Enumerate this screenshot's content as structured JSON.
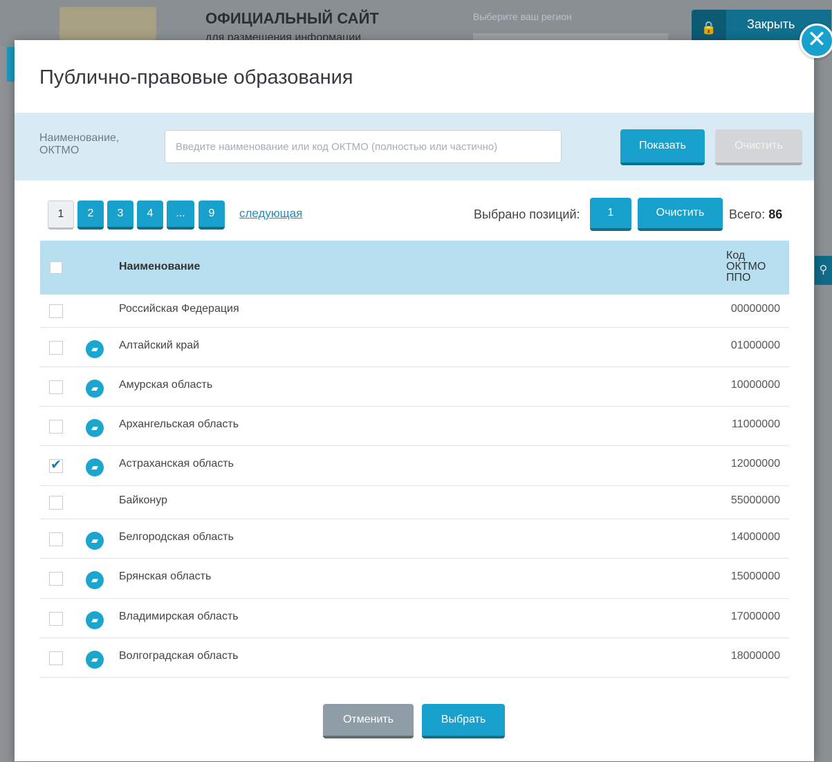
{
  "background": {
    "site_title": "ОФИЦИАЛЬНЫЙ САЙТ",
    "site_subtitle": "для размещения информации",
    "region_label": "Выберите ваш регион",
    "close_label": "Закрыть"
  },
  "modal": {
    "title": "Публично-правовые образования",
    "filter": {
      "label": "Наименование, ОКТМО",
      "placeholder": "Введите наименование или код ОКТМО (полностью или частично)",
      "value": "",
      "show_button": "Показать",
      "clear_button": "Очистить"
    },
    "pager": {
      "pages": [
        "1",
        "2",
        "3",
        "4",
        "...",
        "9"
      ],
      "current": "1",
      "next_label": "следующая"
    },
    "selection": {
      "label": "Выбрано позиций:",
      "count": "1",
      "clear_button": "Очистить",
      "total_label": "Всего:",
      "total_value": "86"
    },
    "table": {
      "header_name": "Наименование",
      "header_code": "Код ОКТМО ППО",
      "rows": [
        {
          "name": "Российская Федерация",
          "code": "00000000",
          "checked": false,
          "folder": false
        },
        {
          "name": "Алтайский край",
          "code": "01000000",
          "checked": false,
          "folder": true
        },
        {
          "name": "Амурская область",
          "code": "10000000",
          "checked": false,
          "folder": true
        },
        {
          "name": "Архангельская область",
          "code": "11000000",
          "checked": false,
          "folder": true
        },
        {
          "name": "Астраханская область",
          "code": "12000000",
          "checked": true,
          "folder": true
        },
        {
          "name": "Байконур",
          "code": "55000000",
          "checked": false,
          "folder": false
        },
        {
          "name": "Белгородская область",
          "code": "14000000",
          "checked": false,
          "folder": true
        },
        {
          "name": "Брянская область",
          "code": "15000000",
          "checked": false,
          "folder": true
        },
        {
          "name": "Владимирская область",
          "code": "17000000",
          "checked": false,
          "folder": true
        },
        {
          "name": "Волгоградская область",
          "code": "18000000",
          "checked": false,
          "folder": true
        }
      ]
    },
    "footer": {
      "cancel_button": "Отменить",
      "select_button": "Выбрать"
    }
  },
  "colors": {
    "accent": "#18a1cc",
    "filter_bg": "#d8ebf5",
    "table_header_bg": "#b7dff0"
  }
}
